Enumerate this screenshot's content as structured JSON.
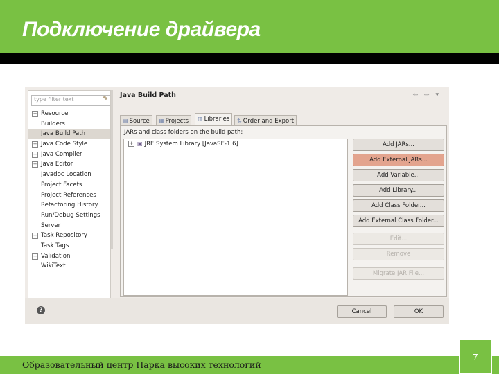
{
  "slide": {
    "title": "Подключение драйвера",
    "footer": "Образовательный центр Парка высоких технологий",
    "page_number": "7",
    "accent_color": "#79c143"
  },
  "filter": {
    "placeholder": "type filter text",
    "clear_icon": "eraser-icon"
  },
  "tree": [
    {
      "label": "Resource",
      "expandable": true
    },
    {
      "label": "Builders",
      "expandable": false
    },
    {
      "label": "Java Build Path",
      "expandable": false,
      "selected": true
    },
    {
      "label": "Java Code Style",
      "expandable": true
    },
    {
      "label": "Java Compiler",
      "expandable": true
    },
    {
      "label": "Java Editor",
      "expandable": true
    },
    {
      "label": "Javadoc Location",
      "expandable": false
    },
    {
      "label": "Project Facets",
      "expandable": false
    },
    {
      "label": "Project References",
      "expandable": false
    },
    {
      "label": "Refactoring History",
      "expandable": false
    },
    {
      "label": "Run/Debug Settings",
      "expandable": false
    },
    {
      "label": "Server",
      "expandable": false
    },
    {
      "label": "Task Repository",
      "expandable": true
    },
    {
      "label": "Task Tags",
      "expandable": false
    },
    {
      "label": "Validation",
      "expandable": true
    },
    {
      "label": "WikiText",
      "expandable": false
    }
  ],
  "page": {
    "title": "Java Build Path",
    "nav_icons": [
      "back-icon",
      "forward-icon",
      "menu-icon"
    ]
  },
  "tabs": [
    {
      "label": "Source",
      "icon": "source-folder-icon"
    },
    {
      "label": "Projects",
      "icon": "projects-icon"
    },
    {
      "label": "Libraries",
      "icon": "libraries-icon",
      "active": true
    },
    {
      "label": "Order and Export",
      "icon": "order-icon"
    }
  ],
  "libraries": {
    "caption": "JARs and class folders on the build path:",
    "items": [
      {
        "label": "JRE System Library [JavaSE-1.6]",
        "icon": "library-jar-icon"
      }
    ]
  },
  "buttons": [
    {
      "label": "Add JARs...",
      "state": "normal"
    },
    {
      "label": "Add External JARs...",
      "state": "hover"
    },
    {
      "label": "Add Variable...",
      "state": "normal"
    },
    {
      "label": "Add Library...",
      "state": "normal"
    },
    {
      "label": "Add Class Folder...",
      "state": "normal"
    },
    {
      "label": "Add External Class Folder...",
      "state": "normal"
    },
    {
      "label": "Edit...",
      "state": "disabled"
    },
    {
      "label": "Remove",
      "state": "disabled"
    },
    {
      "label": "Migrate JAR File...",
      "state": "disabled"
    }
  ],
  "dialog": {
    "cancel_label": "Cancel",
    "ok_label": "OK",
    "help_icon": "help-icon"
  }
}
